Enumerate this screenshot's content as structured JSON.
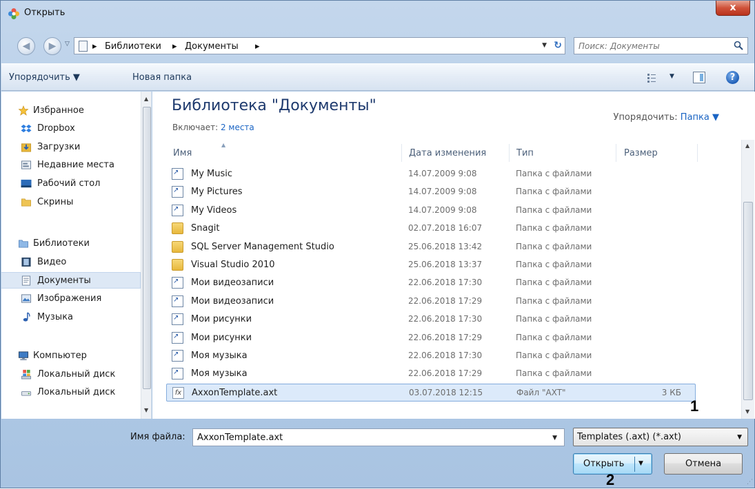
{
  "window": {
    "title": "Открыть",
    "close_label": "x"
  },
  "address": {
    "crumbs": [
      "Библиотеки",
      "Документы"
    ],
    "separator": "▸",
    "dropdown": "▼",
    "refresh": "↻"
  },
  "search": {
    "placeholder": "Поиск: Документы"
  },
  "toolbar": {
    "organize_label": "Упорядочить ▼",
    "new_folder_label": "Новая папка",
    "view_dd": "▼",
    "help": "?"
  },
  "nav": {
    "favorites": [
      {
        "label": "Избранное",
        "icon": "star-icon"
      },
      {
        "label": "Dropbox",
        "icon": "dropbox-icon"
      },
      {
        "label": "Загрузки",
        "icon": "downloads-icon"
      },
      {
        "label": "Недавние места",
        "icon": "recent-places-icon"
      },
      {
        "label": "Рабочий стол",
        "icon": "desktop-icon"
      },
      {
        "label": "Скрины",
        "icon": "folder-icon"
      }
    ],
    "libraries": [
      {
        "label": "Библиотеки",
        "icon": "libraries-icon"
      },
      {
        "label": "Видео",
        "icon": "video-icon"
      },
      {
        "label": "Документы",
        "icon": "documents-icon"
      },
      {
        "label": "Изображения",
        "icon": "images-icon"
      },
      {
        "label": "Музыка",
        "icon": "music-icon"
      }
    ],
    "computer": [
      {
        "label": "Компьютер",
        "icon": "computer-icon"
      },
      {
        "label": "Локальный диск",
        "icon": "drive-icon"
      },
      {
        "label": "Локальный диск",
        "icon": "drive-icon"
      }
    ]
  },
  "library": {
    "title": "Библиотека \"Документы\"",
    "includes_label": "Включает:",
    "includes_link": "2 места",
    "arrange_label": "Упорядочить:",
    "arrange_value": "Папка ▼"
  },
  "columns": {
    "name": "Имя",
    "date": "Дата изменения",
    "type": "Тип",
    "size": "Размер"
  },
  "files": [
    {
      "name": "My Music",
      "date": "14.07.2009 9:08",
      "type": "Папка с файлами",
      "size": "",
      "icon": "shortcut-folder-icon"
    },
    {
      "name": "My Pictures",
      "date": "14.07.2009 9:08",
      "type": "Папка с файлами",
      "size": "",
      "icon": "shortcut-folder-icon"
    },
    {
      "name": "My Videos",
      "date": "14.07.2009 9:08",
      "type": "Папка с файлами",
      "size": "",
      "icon": "shortcut-folder-icon"
    },
    {
      "name": "Snagit",
      "date": "02.07.2018 16:07",
      "type": "Папка с файлами",
      "size": "",
      "icon": "folder-icon"
    },
    {
      "name": "SQL Server Management Studio",
      "date": "25.06.2018 13:42",
      "type": "Папка с файлами",
      "size": "",
      "icon": "folder-icon"
    },
    {
      "name": "Visual Studio 2010",
      "date": "25.06.2018 13:37",
      "type": "Папка с файлами",
      "size": "",
      "icon": "folder-icon"
    },
    {
      "name": "Мои видеозаписи",
      "date": "22.06.2018 17:30",
      "type": "Папка с файлами",
      "size": "",
      "icon": "shortcut-folder-icon"
    },
    {
      "name": "Мои видеозаписи",
      "date": "22.06.2018 17:29",
      "type": "Папка с файлами",
      "size": "",
      "icon": "shortcut-folder-icon"
    },
    {
      "name": "Мои рисунки",
      "date": "22.06.2018 17:30",
      "type": "Папка с файлами",
      "size": "",
      "icon": "shortcut-folder-icon"
    },
    {
      "name": "Мои рисунки",
      "date": "22.06.2018 17:29",
      "type": "Папка с файлами",
      "size": "",
      "icon": "shortcut-folder-icon"
    },
    {
      "name": "Моя музыка",
      "date": "22.06.2018 17:30",
      "type": "Папка с файлами",
      "size": "",
      "icon": "shortcut-folder-icon"
    },
    {
      "name": "Моя музыка",
      "date": "22.06.2018 17:29",
      "type": "Папка с файлами",
      "size": "",
      "icon": "shortcut-folder-icon"
    },
    {
      "name": "AxxonTemplate.axt",
      "date": "03.07.2018 12:15",
      "type": "Файл \"AXT\"",
      "size": "3 КБ",
      "icon": "axt-file-icon",
      "selected": true
    }
  ],
  "bottom": {
    "filename_label": "Имя файла:",
    "filename_value": "AxxonTemplate.axt",
    "filter_value": "Templates (.axt) (*.axt)",
    "open_label": "Открыть",
    "cancel_label": "Отмена"
  },
  "annotations": {
    "marker_1": "1",
    "marker_2": "2"
  },
  "colors": {
    "accent": "#1a64c4",
    "title_blue": "#1e3a6e",
    "selection": "#dceafa"
  }
}
